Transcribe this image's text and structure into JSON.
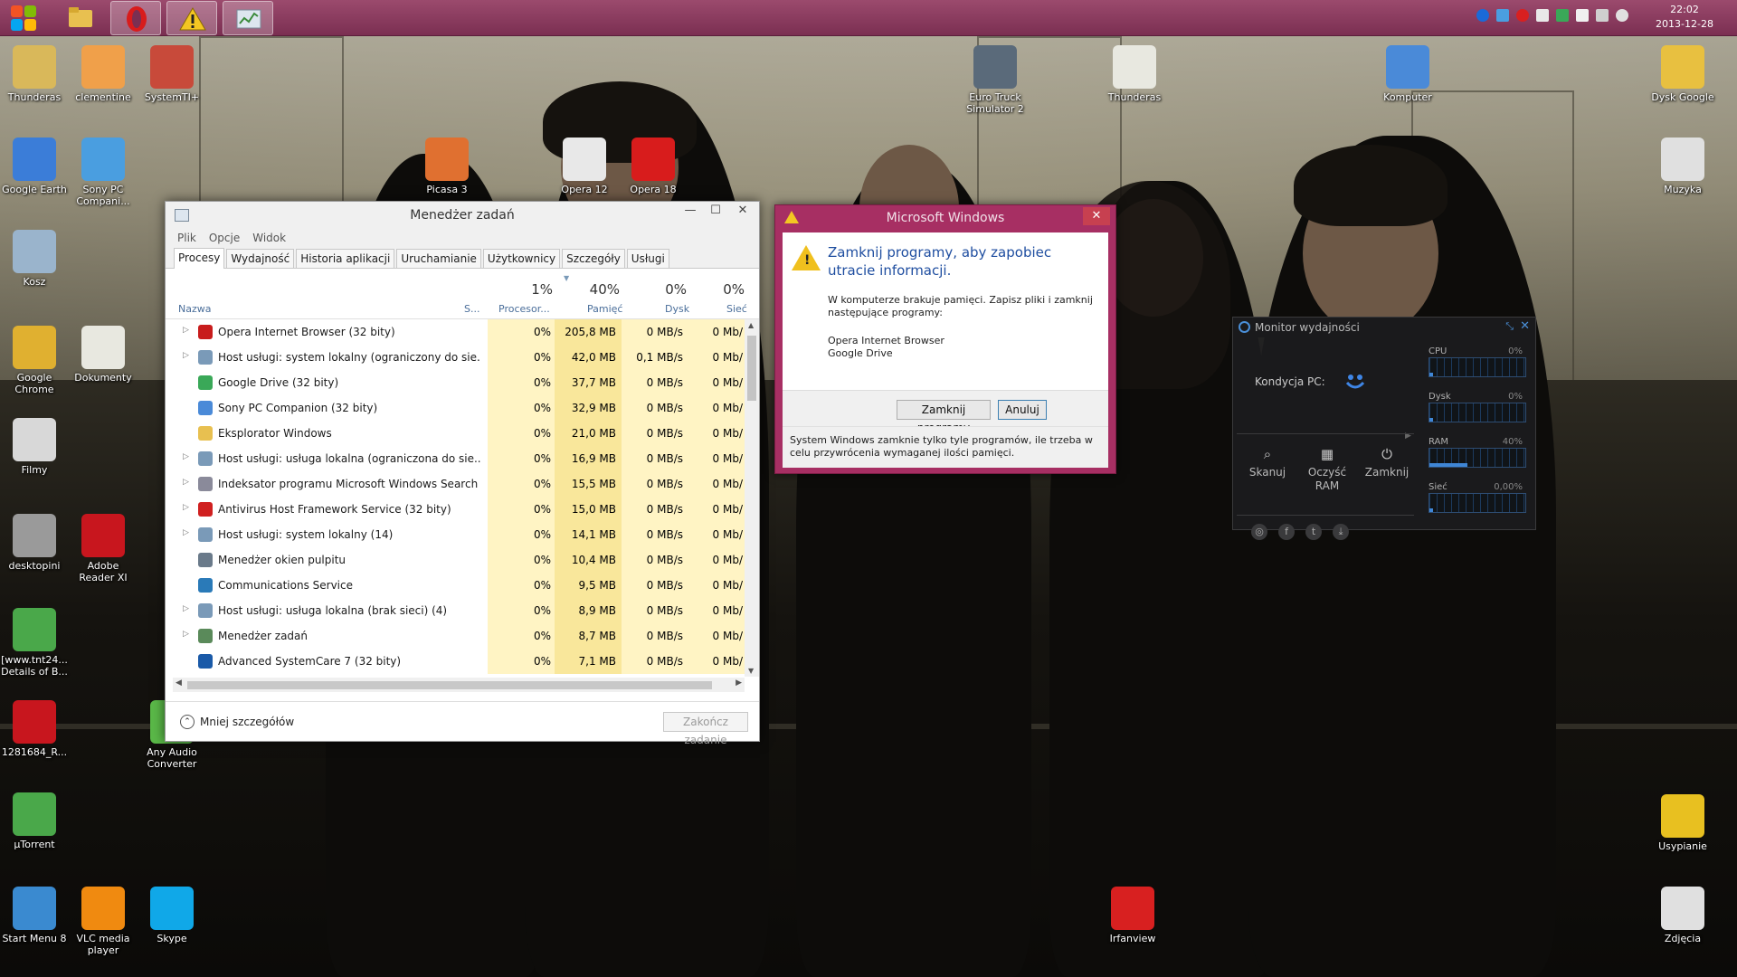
{
  "taskbar": {
    "clock_time": "22:02",
    "clock_date": "2013-12-28",
    "buttons": [
      "file-explorer",
      "opera",
      "warning",
      "task-manager"
    ]
  },
  "desktop_icons_left": [
    {
      "label": "Thunderas",
      "icon": "user-folder-icon",
      "color": "#d9b85a"
    },
    {
      "label": "clementine",
      "icon": "clementine-icon",
      "color": "#f0a04a"
    },
    {
      "label": "SystemTI+",
      "icon": "system-tool-icon",
      "color": "#c84a3a"
    },
    {
      "label": "Google Earth",
      "icon": "google-earth-icon",
      "color": "#3b7dd8"
    },
    {
      "label": "Sony PC Compani...",
      "icon": "sony-pc-icon",
      "color": "#4a9ee0"
    },
    {
      "label": "Kosz",
      "icon": "recycle-bin-icon",
      "color": "#9ab4cc"
    },
    {
      "label": "Google Chrome",
      "icon": "chrome-icon",
      "color": "#e0b030"
    },
    {
      "label": "Dokumenty",
      "icon": "documents-icon",
      "color": "#e8e8e0"
    },
    {
      "label": "Filmy",
      "icon": "movies-icon",
      "color": "#d8d8d8"
    },
    {
      "label": "desktopini",
      "icon": "desktopini-icon",
      "color": "#9a9a9a"
    },
    {
      "label": "Adobe Reader XI",
      "icon": "adobe-reader-icon",
      "color": "#c8161e"
    },
    {
      "label": "[www.tnt24... Details of B...",
      "icon": "utorrent-file-icon",
      "color": "#4aa84a"
    },
    {
      "label": "1281684_R...",
      "icon": "pdf-file-icon",
      "color": "#c8161e"
    },
    {
      "label": "Any Audio Converter",
      "icon": "audio-converter-icon",
      "color": "#5ab848"
    },
    {
      "label": "µTorrent",
      "icon": "utorrent-icon",
      "color": "#4aa84a"
    },
    {
      "label": "Start Menu 8",
      "icon": "start-menu-icon",
      "color": "#3a8ad0"
    },
    {
      "label": "VLC media player",
      "icon": "vlc-icon",
      "color": "#f08a10"
    },
    {
      "label": "Skype",
      "icon": "skype-icon",
      "color": "#10a8e8"
    }
  ],
  "desktop_icons_top": [
    {
      "label": "Picasa 3",
      "icon": "picasa-icon",
      "color": "#e07030"
    },
    {
      "label": "Opera 12",
      "icon": "opera12-icon",
      "color": "#e8e8e8"
    },
    {
      "label": "Opera 18",
      "icon": "opera18-icon",
      "color": "#d81c1c"
    },
    {
      "label": "Euro Truck Simulator 2",
      "icon": "truck-icon",
      "color": "#5a6a7a"
    },
    {
      "label": "Thunderas",
      "icon": "document-icon",
      "color": "#e8e8e0"
    },
    {
      "label": "Komputer",
      "icon": "computer-icon",
      "color": "#4a8ad8"
    },
    {
      "label": "Dysk Google",
      "icon": "google-drive-folder-icon",
      "color": "#e8c040"
    },
    {
      "label": "Muzyka",
      "icon": "music-icon",
      "color": "#e0e0e0"
    },
    {
      "label": "Usypianie",
      "icon": "sleep-icon",
      "color": "#e8c020"
    },
    {
      "label": "Zdjęcia",
      "icon": "pictures-icon",
      "color": "#e0e0e0"
    },
    {
      "label": "Irfanview",
      "icon": "irfanview-icon",
      "color": "#d82020"
    }
  ],
  "task_manager": {
    "title": "Menedżer zadań",
    "menu": [
      "Plik",
      "Opcje",
      "Widok"
    ],
    "tabs": [
      "Procesy",
      "Wydajność",
      "Historia aplikacji",
      "Uruchamianie",
      "Użytkownicy",
      "Szczegóły",
      "Usługi"
    ],
    "columns": {
      "name": "Nazwa",
      "status": "S...",
      "cpu_pct": "1%",
      "cpu": "Procesor...",
      "mem_pct": "40%",
      "mem": "Pamięć",
      "disk_pct": "0%",
      "disk": "Dysk",
      "net_pct": "0%",
      "net": "Sieć"
    },
    "rows": [
      {
        "name": "Opera Internet Browser (32 bity)",
        "expand": true,
        "icon": "opera-icon",
        "color": "#c81c1c",
        "cpu": "0%",
        "mem": "205,8 MB",
        "disk": "0 MB/s",
        "net": "0 Mb/"
      },
      {
        "name": "Host usługi: system lokalny (ograniczony do sie...",
        "expand": true,
        "icon": "gear-icon",
        "color": "#7a9ab8",
        "cpu": "0%",
        "mem": "42,0 MB",
        "disk": "0,1 MB/s",
        "net": "0 Mb/"
      },
      {
        "name": "Google Drive (32 bity)",
        "expand": false,
        "icon": "google-drive-icon",
        "color": "#3aa858",
        "cpu": "0%",
        "mem": "37,7 MB",
        "disk": "0 MB/s",
        "net": "0 Mb/"
      },
      {
        "name": "Sony PC Companion (32 bity)",
        "expand": false,
        "icon": "sony-icon",
        "color": "#4a8ad8",
        "cpu": "0%",
        "mem": "32,9 MB",
        "disk": "0 MB/s",
        "net": "0 Mb/"
      },
      {
        "name": "Eksplorator Windows",
        "expand": false,
        "icon": "folder-icon",
        "color": "#e8c050",
        "cpu": "0%",
        "mem": "21,0 MB",
        "disk": "0 MB/s",
        "net": "0 Mb/"
      },
      {
        "name": "Host usługi: usługa lokalna (ograniczona do sie...",
        "expand": true,
        "icon": "gear-icon",
        "color": "#7a9ab8",
        "cpu": "0%",
        "mem": "16,9 MB",
        "disk": "0 MB/s",
        "net": "0 Mb/"
      },
      {
        "name": "Indeksator programu Microsoft Windows Search",
        "expand": true,
        "icon": "search-indexer-icon",
        "color": "#8a8a9a",
        "cpu": "0%",
        "mem": "15,5 MB",
        "disk": "0 MB/s",
        "net": "0 Mb/"
      },
      {
        "name": "Antivirus Host Framework Service (32 bity)",
        "expand": true,
        "icon": "antivirus-icon",
        "color": "#d02020",
        "cpu": "0%",
        "mem": "15,0 MB",
        "disk": "0 MB/s",
        "net": "0 Mb/"
      },
      {
        "name": "Host usługi: system lokalny (14)",
        "expand": true,
        "icon": "gear-icon",
        "color": "#7a9ab8",
        "cpu": "0%",
        "mem": "14,1 MB",
        "disk": "0 MB/s",
        "net": "0 Mb/"
      },
      {
        "name": "Menedżer okien pulpitu",
        "expand": false,
        "icon": "window-manager-icon",
        "color": "#6a7a8a",
        "cpu": "0%",
        "mem": "10,4 MB",
        "disk": "0 MB/s",
        "net": "0 Mb/"
      },
      {
        "name": "Communications Service",
        "expand": false,
        "icon": "mail-icon",
        "color": "#2a7ab8",
        "cpu": "0%",
        "mem": "9,5 MB",
        "disk": "0 MB/s",
        "net": "0 Mb/"
      },
      {
        "name": "Host usługi: usługa lokalna (brak sieci) (4)",
        "expand": true,
        "icon": "gear-icon",
        "color": "#7a9ab8",
        "cpu": "0%",
        "mem": "8,9 MB",
        "disk": "0 MB/s",
        "net": "0 Mb/"
      },
      {
        "name": "Menedżer zadań",
        "expand": true,
        "icon": "task-manager-icon",
        "color": "#5a8a5a",
        "cpu": "0%",
        "mem": "8,7 MB",
        "disk": "0 MB/s",
        "net": "0 Mb/"
      },
      {
        "name": "Advanced SystemCare 7 (32 bity)",
        "expand": false,
        "icon": "systemcare-icon",
        "color": "#1a5aa8",
        "cpu": "0%",
        "mem": "7,1 MB",
        "disk": "0 MB/s",
        "net": "0 Mb/"
      }
    ],
    "less_details": "Mniej szczegółów",
    "end_task": "Zakończ zadanie"
  },
  "dialog": {
    "title": "Microsoft Windows",
    "heading": "Zamknij programy, aby zapobiec utracie informacji.",
    "text": "W komputerze brakuje pamięci. Zapisz pliki i zamknij następujące programy:",
    "programs": [
      "Opera Internet Browser",
      "Google Drive"
    ],
    "primary_button": "Zamknij programy",
    "cancel_button": "Anuluj",
    "footer": "System Windows zamknie tylko tyle programów, ile trzeba w celu przywrócenia wymaganej ilości pamięci."
  },
  "perf_monitor": {
    "title": "Monitor wydajności",
    "health_label": "Kondycja PC:",
    "tools": [
      {
        "label": "Skanuj",
        "icon": "scan-icon",
        "glyph": "⌕"
      },
      {
        "label": "Oczyść RAM",
        "icon": "ram-icon",
        "glyph": "▦"
      },
      {
        "label": "Zamknij",
        "icon": "power-icon",
        "glyph": "⏻"
      }
    ],
    "social": [
      {
        "icon": "support-icon",
        "glyph": "◎"
      },
      {
        "icon": "facebook-icon",
        "glyph": "f"
      },
      {
        "icon": "twitter-icon",
        "glyph": "t"
      },
      {
        "icon": "download-icon",
        "glyph": "⤓"
      }
    ],
    "graphs": [
      {
        "label": "CPU",
        "value": "0%",
        "level": 0.02
      },
      {
        "label": "Dysk",
        "value": "0%",
        "level": 0.02
      },
      {
        "label": "RAM",
        "value": "40%",
        "level": 0.4
      },
      {
        "label": "Sieć",
        "value": "0,00%",
        "level": 0.02
      }
    ]
  }
}
